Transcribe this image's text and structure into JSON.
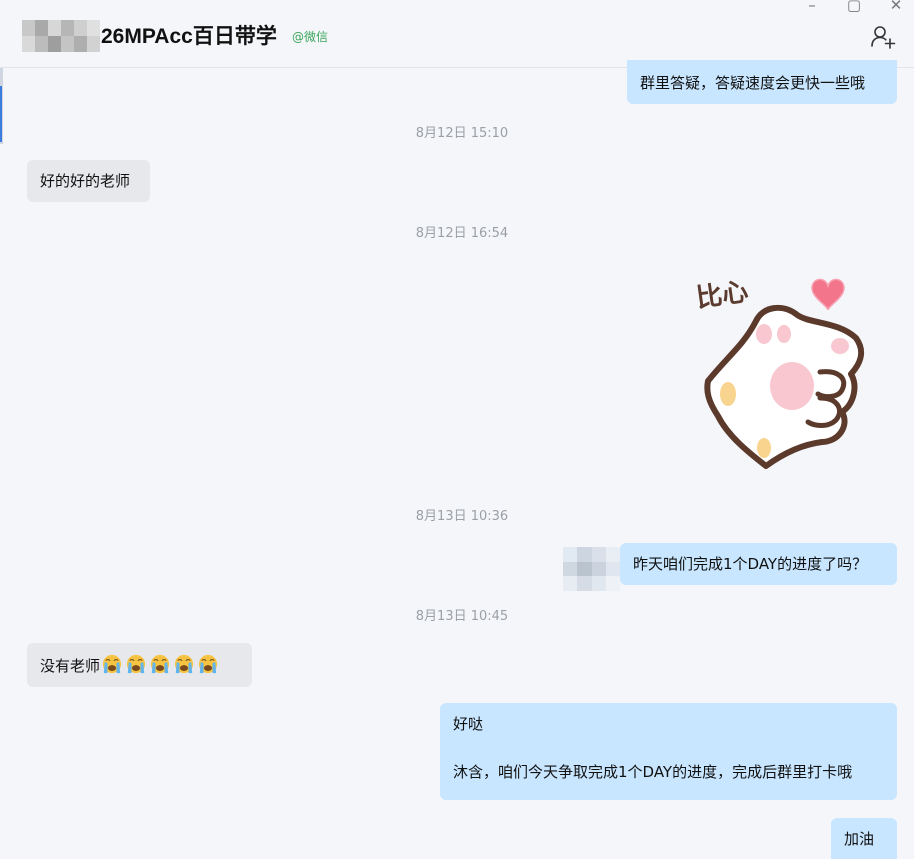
{
  "header": {
    "title": "26MPAcc百日带学",
    "source": "@微信",
    "window_controls": [
      "minimize-icon",
      "maximize-icon",
      "close-icon"
    ],
    "add_member_icon": "add-member-icon"
  },
  "messages": [
    {
      "type": "text",
      "direction": "outgoing",
      "text": "群里答疑，答疑速度会更快一些哦"
    },
    {
      "type": "timestamp",
      "text": "8月12日 15:10"
    },
    {
      "type": "text",
      "direction": "incoming",
      "text": "好的好的老师"
    },
    {
      "type": "timestamp",
      "text": "8月12日 16:54"
    },
    {
      "type": "sticker",
      "direction": "outgoing",
      "text": "比心"
    },
    {
      "type": "timestamp",
      "text": "8月13日 10:36"
    },
    {
      "type": "text",
      "direction": "outgoing",
      "text": "昨天咱们完成1个DAY的进度了吗？"
    },
    {
      "type": "timestamp",
      "text": "8月13日 10:45"
    },
    {
      "type": "text",
      "direction": "incoming",
      "text": "没有老师",
      "emoji": "loudly-crying-face",
      "emoji_count": 5
    },
    {
      "type": "text",
      "direction": "outgoing",
      "lines": [
        "好哒",
        "沐含，咱们今天争取完成1个DAY的进度，完成后群里打卡哦"
      ]
    },
    {
      "type": "text",
      "direction": "outgoing",
      "text": "加油"
    }
  ],
  "colors": {
    "background": "#f5f6fa",
    "incoming_bubble": "#e7e8ec",
    "outgoing_bubble": "#c8e6ff",
    "timestamp": "#9aa0a6",
    "source_tag": "#3aa55b"
  }
}
